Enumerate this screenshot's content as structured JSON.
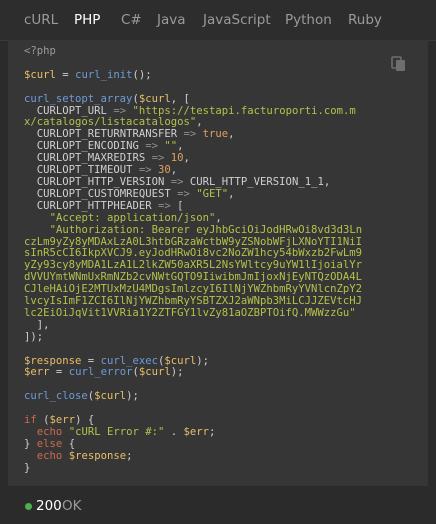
{
  "tabs": [
    {
      "label": "cURL"
    },
    {
      "label": "PHP"
    },
    {
      "label": "C#"
    },
    {
      "label": "Java"
    },
    {
      "label": "JavaScript"
    },
    {
      "label": "Python"
    },
    {
      "label": "Ruby"
    }
  ],
  "active_tab": "PHP",
  "copy_button": {
    "icon": "copy-icon"
  },
  "code": {
    "lines": [
      "<?php",
      "",
      "$curl = curl_init();",
      "",
      "curl_setopt_array($curl, [",
      "  CURLOPT_URL => \"https://testapi.facturoporti.com.m",
      "x/catalogos/listacatalogos\",",
      "  CURLOPT_RETURNTRANSFER => true,",
      "  CURLOPT_ENCODING => \"\",",
      "  CURLOPT_MAXREDIRS => 10,",
      "  CURLOPT_TIMEOUT => 30,",
      "  CURLOPT_HTTP_VERSION => CURL_HTTP_VERSION_1_1,",
      "  CURLOPT_CUSTOMREQUEST => \"GET\",",
      "  CURLOPT_HTTPHEADER => [",
      "    \"Accept: application/json\",",
      "    \"Authorization: Bearer eyJhbGciOiJodHRwOi8vd3d3Ln",
      "czLm9yZy8yMDAxLzA0L3htbGRzaWctbW9yZSNobWFjLXNoYTI1NiI",
      "sInR5cCI6IkpXVCJ9.eyJodHRwOi8vc2NoZW1hcy54bWxzb2FwLm9",
      "yZy93cy8yMDA1LzA1L2lkZW50aXR5L2NsYWltcy9uYW1lIjoialYr",
      "dVVUYmtWNmUxRmNZb2cvNWtGQTO9IiwibmJmIjoxNjEyNTQzODA4L",
      "CJleHAiOjE2MTUxMzU4MDgsImlzcyI6IlNjYWZhbmRyYVNlcnZpY2",
      "lvcyIsImF1ZCI6IlNjYWZhbmRyYSBTZXJ2aWNpb3MiLCJJZEVtcHJ",
      "lc2EiOiJqVit1VVRia1Y2ZTFGY1lvZy81aOZBPTOifQ.MWWzzGu\"",
      "  ],",
      "]);",
      "",
      "$response = curl_exec($curl);",
      "$err = curl_error($curl);",
      "",
      "curl_close($curl);",
      "",
      "if ($err) {",
      "  echo \"cURL Error #:\" . $err;",
      "} else {",
      "  echo $response;",
      "}"
    ]
  },
  "status": {
    "code": "200",
    "text": "OK",
    "color": "#4caf50"
  },
  "colors": {
    "background": "#2b2b2c",
    "code_background": "#363636",
    "keyword": "#cf6a4c",
    "variable": "#e8bf6a",
    "function": "#6f9bd6",
    "string": "#b5c14a",
    "number": "#e0a060"
  }
}
